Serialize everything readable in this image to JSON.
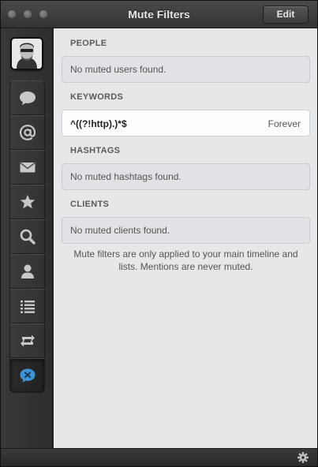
{
  "window": {
    "title": "Mute Filters",
    "edit_label": "Edit"
  },
  "sidebar": {
    "avatar": "user-avatar",
    "items": [
      {
        "name": "timeline",
        "icon": "speech-bubble-icon"
      },
      {
        "name": "mentions",
        "icon": "at-sign-icon"
      },
      {
        "name": "messages",
        "icon": "envelope-icon"
      },
      {
        "name": "favorites",
        "icon": "star-icon"
      },
      {
        "name": "search",
        "icon": "magnifier-icon"
      },
      {
        "name": "profile",
        "icon": "person-icon"
      },
      {
        "name": "lists",
        "icon": "list-icon"
      },
      {
        "name": "retweets",
        "icon": "retweet-icon"
      },
      {
        "name": "mute-filters",
        "icon": "mute-bubble-icon",
        "active": true
      }
    ]
  },
  "sections": {
    "people": {
      "header": "PEOPLE",
      "empty": "No muted users found."
    },
    "keywords": {
      "header": "KEYWORDS",
      "items": [
        {
          "pattern": "^((?!http).)*$",
          "duration": "Forever"
        }
      ]
    },
    "hashtags": {
      "header": "HASHTAGS",
      "empty": "No muted hashtags found."
    },
    "clients": {
      "header": "CLIENTS",
      "empty": "No muted clients found."
    }
  },
  "note": "Mute filters are only applied to your main timeline and lists. Mentions are never muted.",
  "colors": {
    "accent_blue": "#3d95d6",
    "content_bg": "#e6e7e9",
    "sidebar_bg": "#333333"
  }
}
